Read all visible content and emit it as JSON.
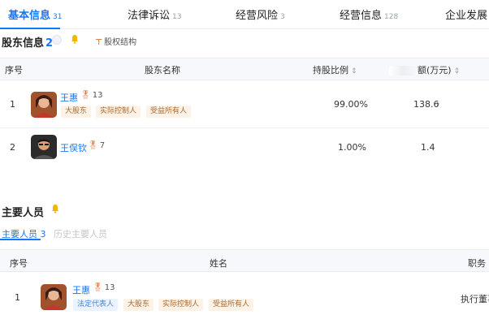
{
  "tabs": [
    {
      "label": "基本信息",
      "count": "31",
      "active": true
    },
    {
      "label": "法律诉讼",
      "count": "13",
      "active": false
    },
    {
      "label": "经营风险",
      "count": "3",
      "active": false
    },
    {
      "label": "经营信息",
      "count": "128",
      "active": false
    },
    {
      "label": "企业发展",
      "count": "",
      "active": false
    }
  ],
  "shareholders": {
    "title": "股东信息",
    "count": "2",
    "equity_link": "股权结构",
    "headers": {
      "index": "序号",
      "name": "股东名称",
      "ratio": "持股比例",
      "amount": "额(万元)"
    },
    "rows": [
      {
        "index": "1",
        "name": "王惠",
        "medal_count": "13",
        "tags": [
          "大股东",
          "实际控制人",
          "受益所有人"
        ],
        "ratio": "99.00%",
        "amount": "138.6"
      },
      {
        "index": "2",
        "name": "王俣钦",
        "medal_count": "7",
        "tags": [],
        "ratio": "1.00%",
        "amount": "1.4"
      }
    ]
  },
  "personnel": {
    "title": "主要人员",
    "subtabs": [
      {
        "label": "主要人员",
        "count": "3",
        "active": true
      },
      {
        "label": "历史主要人员",
        "count": "",
        "active": false
      }
    ],
    "headers": {
      "index": "序号",
      "name": "姓名",
      "role": "职务"
    },
    "rows": [
      {
        "index": "1",
        "name": "王惠",
        "medal_count": "13",
        "tags": [
          "法定代表人",
          "大股东",
          "实际控制人",
          "受益所有人"
        ],
        "role": "执行董事"
      }
    ]
  },
  "colors": {
    "accent": "#1677ff",
    "tag_bg": "#fdf2e6",
    "tag_fg": "#a86a34",
    "header_bg": "#f6f8fb"
  },
  "icons": {
    "sort": "sort-arrows-icon",
    "medal": "medal-icon",
    "bell": "bell-icon",
    "chevron": "chevron-right-icon"
  }
}
